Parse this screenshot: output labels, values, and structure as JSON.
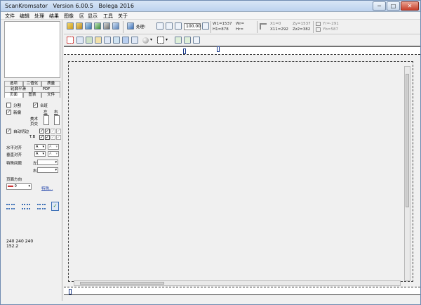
{
  "window": {
    "title": "ScanKromsator   Version 6.00.5   Bolega 2016",
    "controls": {
      "minimize": "─",
      "maximize": "□",
      "close": "✕"
    }
  },
  "menu": [
    "文件",
    "编辑",
    "处理",
    "结果",
    "图像",
    "区",
    "显示",
    "工具",
    "关于"
  ],
  "left_panel": {
    "tabs_row1": [
      "选项",
      "二值化",
      "质量"
    ],
    "tabs_row2": [
      "轮廓平滑",
      "PDF"
    ],
    "tabs_row3": [
      "页面",
      "图表",
      "文件"
    ],
    "split_label": "分割",
    "merge_label": "合班",
    "new_label": "新偏",
    "left_label": "左",
    "right_label": "右",
    "beauty_label": "美术",
    "cross_label": "页交",
    "auto_cut_label": "自动切边",
    "tb_label": "T.B",
    "h_align_label": "水平对齐",
    "v_align_label": "垂直对齐",
    "special_label": "特殊间题",
    "left_short": "左",
    "right_short": "右",
    "align_value": "A",
    "page_dir_label": "页面方向",
    "page_dir_value": "0",
    "special_link": "特殊...",
    "color_info": "240 240 240",
    "color_info2": "152.2"
  },
  "toolbar": {
    "process_label": "处理!",
    "zoom_value": "100.00",
    "readout_w1": "W1=1537",
    "readout_h1": "H1=878",
    "readout_wr": "Wr=",
    "readout_hr": "Hr=",
    "readout_x1": "X1=0",
    "readout_x11": "X11=292",
    "readout_y1": "Zy=1537",
    "readout_y2": "Zz2=382",
    "readout_yr": "Yr=-291",
    "readout_yb": "Yb=587"
  },
  "colors": {
    "accent": "#3b6fb6",
    "title_gradient_top": "#d8e6f6",
    "title_gradient_bottom": "#bcd2ee",
    "close": "#c8412b"
  }
}
